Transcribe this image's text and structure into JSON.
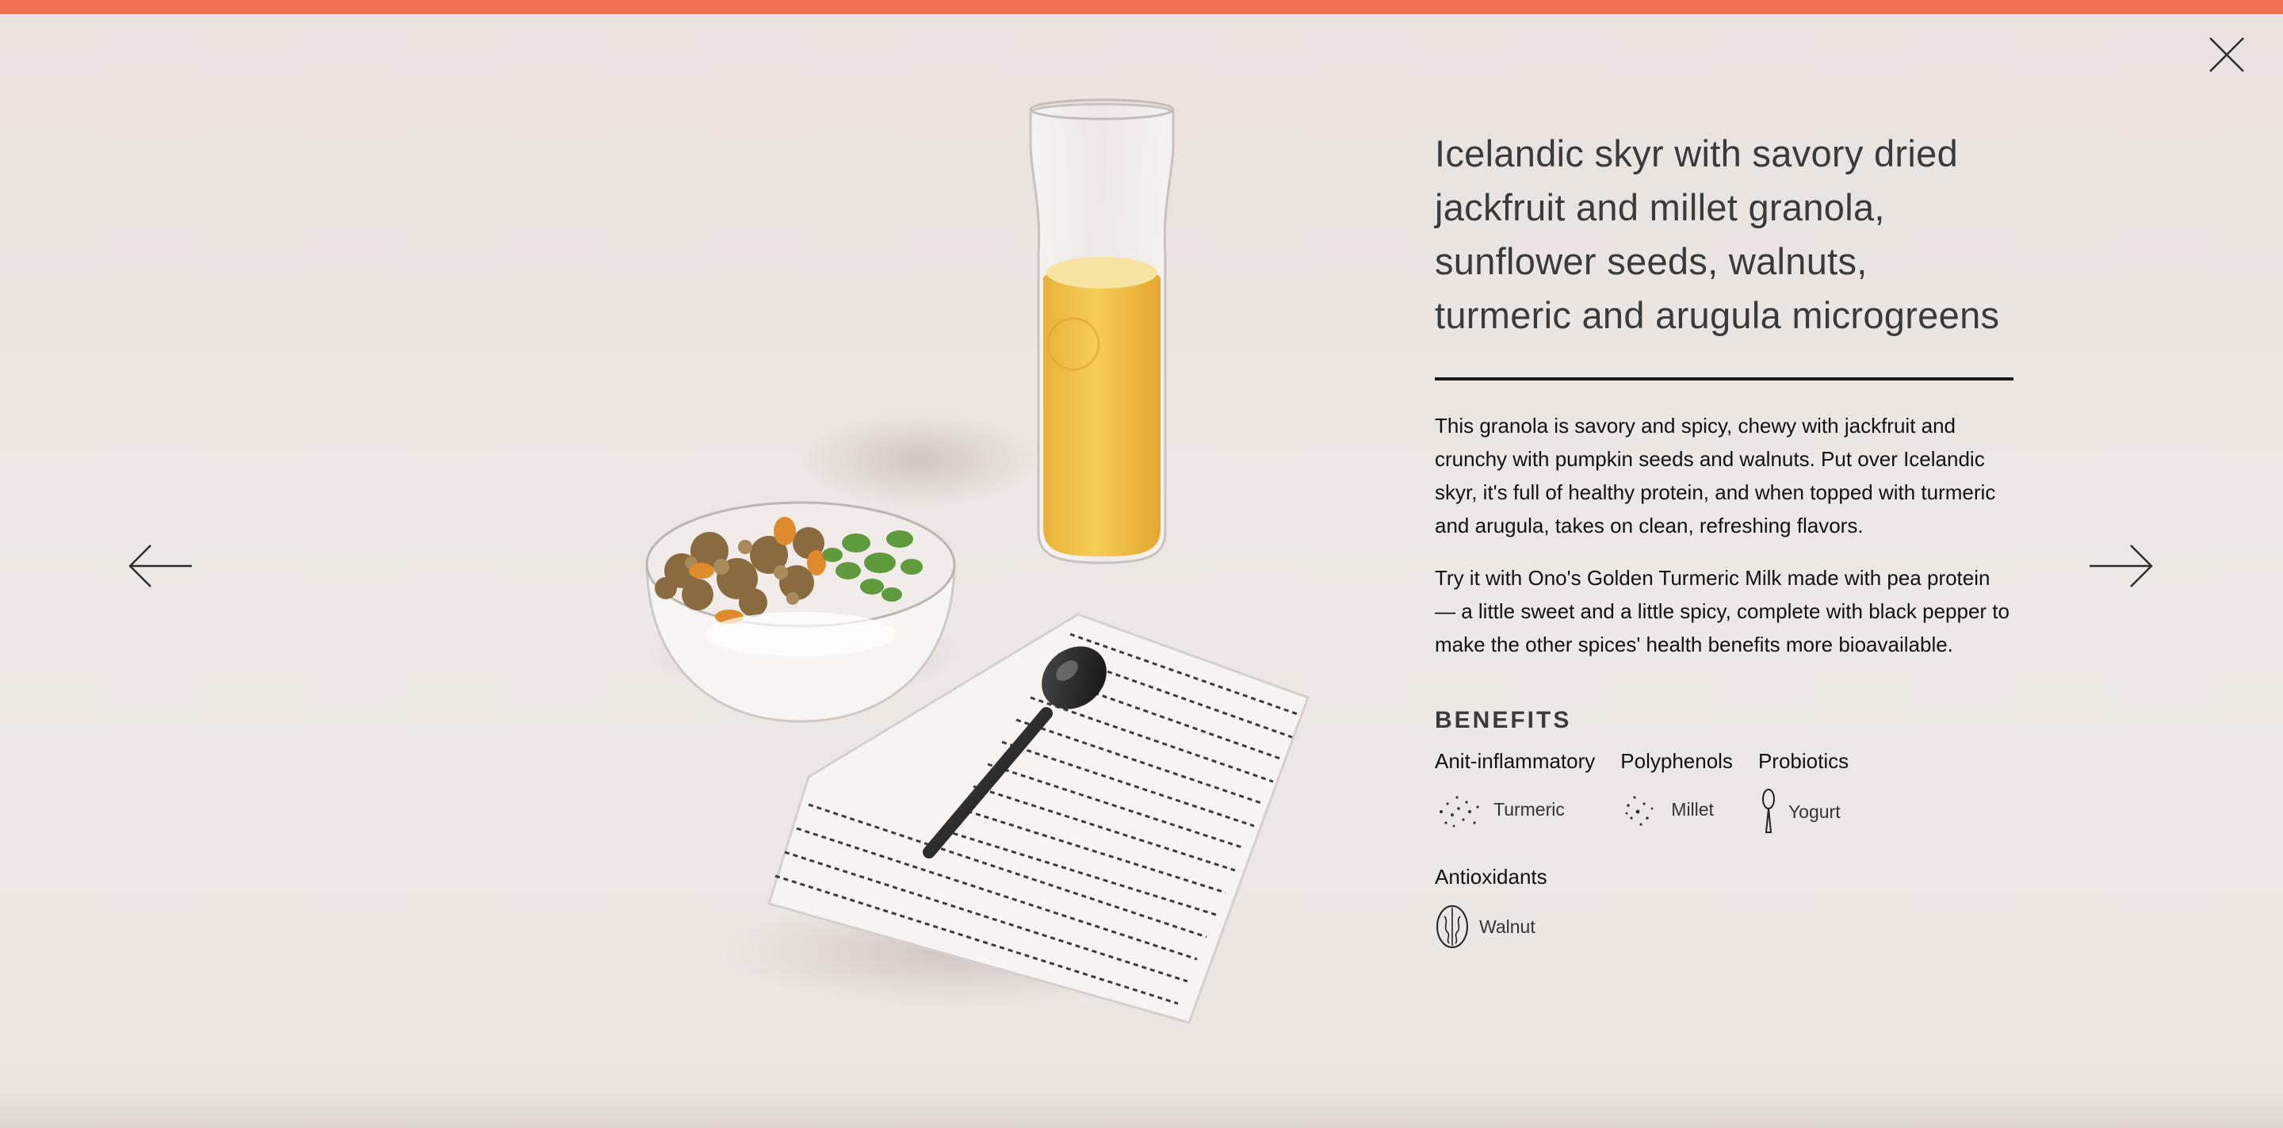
{
  "colors": {
    "accent_bar": "#f0704f",
    "background": "#ece6e3",
    "text": "#1e1e1e",
    "milk": "#f2c44a"
  },
  "nav": {
    "close_icon": "close-x-icon",
    "prev_icon": "arrow-left-icon",
    "next_icon": "arrow-right-icon"
  },
  "product": {
    "title": "Icelandic skyr with savory dried jackfruit and millet granola, sunflower seeds, walnuts, turmeric and arugula microgreens",
    "description": [
      "This granola is savory and spicy, chewy with jackfruit and crunchy with pumpkin seeds and walnuts. Put over Icelandic skyr, it's full of healthy protein, and when topped with turmeric and arugula, takes on clean, refreshing flavors.",
      "Try it with Ono's Golden Turmeric Milk made with pea protein — a little sweet and a little spicy, complete with black pepper to make the other spices' health benefits more bioavailable."
    ]
  },
  "benefits": {
    "heading": "BENEFITS",
    "groups": [
      {
        "label": "Anit-inflammatory",
        "ingredient": "Turmeric",
        "icon": "turmeric-dots-icon"
      },
      {
        "label": "Polyphenols",
        "ingredient": "Millet",
        "icon": "millet-dots-icon"
      },
      {
        "label": "Probiotics",
        "ingredient": "Yogurt",
        "icon": "spoon-icon"
      },
      {
        "label": "Antioxidants",
        "ingredient": "Walnut",
        "icon": "walnut-icon"
      }
    ]
  }
}
